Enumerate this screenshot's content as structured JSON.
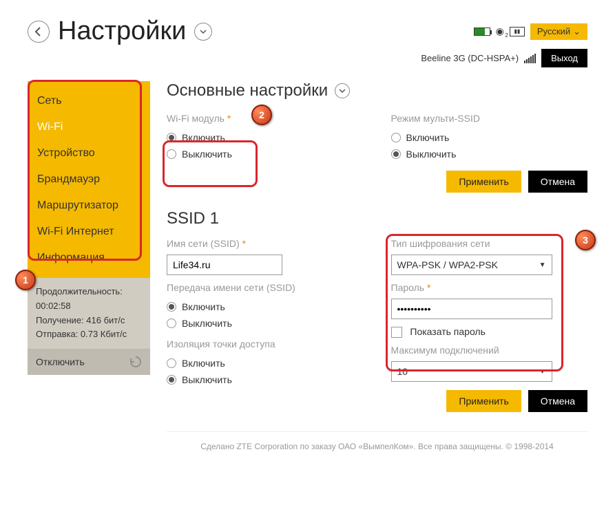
{
  "header": {
    "title": "Настройки",
    "language": "Русский",
    "wifi_count": "2",
    "status_text": "Beeline 3G (DC-HSPA+)",
    "exit_label": "Выход"
  },
  "sidebar": {
    "items": [
      {
        "label": "Сеть"
      },
      {
        "label": "Wi-Fi"
      },
      {
        "label": "Устройство"
      },
      {
        "label": "Брандмауэр"
      },
      {
        "label": "Маршрутизатор"
      },
      {
        "label": "Wi-Fi  Интернет"
      },
      {
        "label": "Информация"
      }
    ],
    "stats": {
      "duration_label": "Продолжительность:",
      "duration_value": "00:02:58",
      "rx_label": "Получение: 416 бит/с",
      "tx_label": "Отправка: 0.73 Кбит/с"
    },
    "disconnect_label": "Отключить"
  },
  "main": {
    "section_title": "Основные настройки",
    "wifi_module": {
      "label": "Wi-Fi модуль",
      "on": "Включить",
      "off": "Выключить"
    },
    "multi_ssid": {
      "label": "Режим мульти-SSID",
      "on": "Включить",
      "off": "Выключить"
    },
    "apply_label": "Применить",
    "cancel_label": "Отмена",
    "ssid_title": "SSID 1",
    "ssid_name": {
      "label": "Имя сети (SSID)",
      "value": "Life34.ru"
    },
    "broadcast": {
      "label": "Передача имени сети (SSID)",
      "on": "Включить",
      "off": "Выключить"
    },
    "isolation": {
      "label": "Изоляция точки доступа",
      "on": "Включить",
      "off": "Выключить"
    },
    "encryption": {
      "label": "Тип шифрования сети",
      "value": "WPA-PSK / WPA2-PSK"
    },
    "password": {
      "label": "Пароль",
      "value": "••••••••••"
    },
    "show_password_label": "Показать пароль",
    "max_conn": {
      "label": "Максимум подключений",
      "value": "10"
    }
  },
  "callouts": {
    "c1": "1",
    "c2": "2",
    "c3": "3"
  },
  "footer": "Сделано ZTE Corporation по заказу ОАО «ВымпелКом». Все права защищены. © 1998-2014"
}
